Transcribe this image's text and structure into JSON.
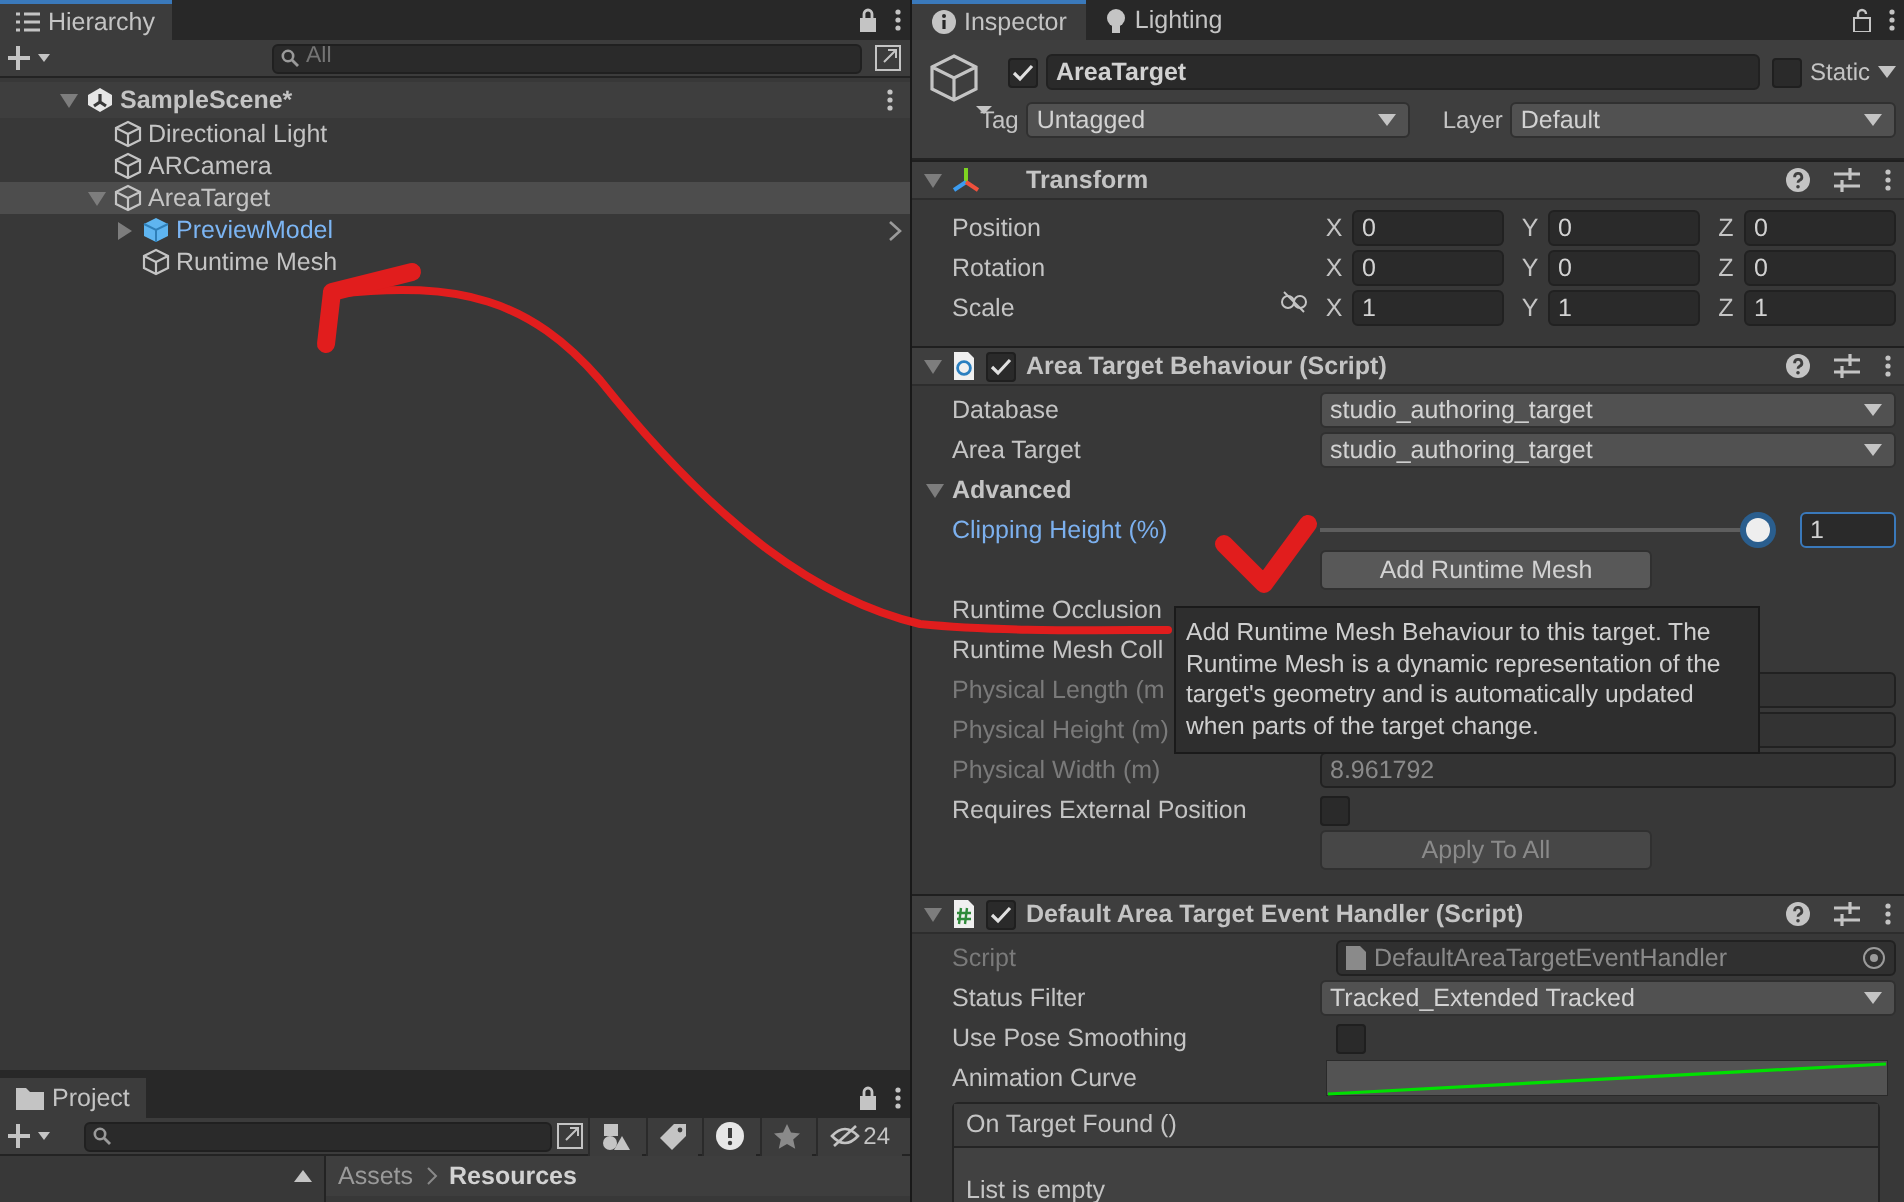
{
  "hierarchy": {
    "tab": "Hierarchy",
    "search": {
      "placeholder": "All"
    },
    "tree": [
      {
        "label": "SampleScene*",
        "kind": "scene",
        "expanded": true,
        "selected": false,
        "children": [
          {
            "label": "Directional Light",
            "kind": "object",
            "selected": false
          },
          {
            "label": "ARCamera",
            "kind": "object",
            "selected": false
          },
          {
            "label": "AreaTarget",
            "kind": "object",
            "expanded": true,
            "selected": true,
            "children": [
              {
                "label": "PreviewModel",
                "kind": "prefab",
                "expanded": false,
                "selected": false
              },
              {
                "label": "Runtime Mesh",
                "kind": "object",
                "selected": false
              }
            ]
          }
        ]
      }
    ]
  },
  "project": {
    "tab": "Project",
    "hidden_count": "24",
    "breadcrumb": [
      "Assets",
      "Resources"
    ]
  },
  "inspector": {
    "tabs": [
      {
        "label": "Inspector",
        "kind": "info",
        "selected": true
      },
      {
        "label": "Lighting",
        "kind": "bulb",
        "selected": false
      }
    ],
    "object": {
      "active": true,
      "name": "AreaTarget",
      "static": false,
      "static_label": "Static",
      "tag_label": "Tag",
      "tag": "Untagged",
      "layer_label": "Layer",
      "layer": "Default"
    },
    "components": [
      {
        "kind": "transform",
        "title": "Transform",
        "expanded": true,
        "rows": [
          {
            "label": "Position",
            "values": [
              {
                "axis": "X",
                "value": "0"
              },
              {
                "axis": "Y",
                "value": "0"
              },
              {
                "axis": "Z",
                "value": "0"
              }
            ]
          },
          {
            "label": "Rotation",
            "values": [
              {
                "axis": "X",
                "value": "0"
              },
              {
                "axis": "Y",
                "value": "0"
              },
              {
                "axis": "Z",
                "value": "0"
              }
            ]
          },
          {
            "label": "Scale",
            "linked": false,
            "values": [
              {
                "axis": "X",
                "value": "1"
              },
              {
                "axis": "Y",
                "value": "1"
              },
              {
                "axis": "Z",
                "value": "1"
              }
            ]
          }
        ]
      },
      {
        "kind": "script",
        "title": "Area Target Behaviour (Script)",
        "expanded": true,
        "enabled": true,
        "fields": [
          {
            "kind": "dropdown",
            "label": "Database",
            "value": "studio_authoring_target"
          },
          {
            "kind": "dropdown",
            "label": "Area Target",
            "value": "studio_authoring_target"
          },
          {
            "kind": "foldout",
            "label": "Advanced",
            "expanded": true
          },
          {
            "kind": "slider",
            "label": "Clipping Height (%)",
            "modified": true,
            "level": 1,
            "value": "1"
          },
          {
            "kind": "button",
            "label": "Add Runtime Mesh",
            "disabled": false
          },
          {
            "kind": "label",
            "label": "Runtime Occlusion"
          },
          {
            "kind": "label",
            "label": "Runtime Mesh Coll"
          },
          {
            "kind": "field",
            "label": "Physical Length (m",
            "disabled": true
          },
          {
            "kind": "field",
            "label": "Physical Height (m)",
            "disabled": true
          },
          {
            "kind": "field",
            "label": "Physical Width (m)",
            "value": "8.961792",
            "disabled": true
          },
          {
            "kind": "checkbox",
            "label": "Requires External Position",
            "checked": false
          },
          {
            "kind": "button",
            "label": "Apply To All",
            "disabled": true
          }
        ]
      },
      {
        "kind": "handler",
        "title": "Default Area Target Event Handler (Script)",
        "expanded": true,
        "enabled": true,
        "fields": [
          {
            "kind": "object",
            "label": "Script",
            "value": "DefaultAreaTargetEventHandler",
            "disabled": true
          },
          {
            "kind": "dropdown",
            "label": "Status Filter",
            "value": "Tracked_Extended Tracked"
          },
          {
            "kind": "checkbox",
            "label": "Use Pose Smoothing",
            "checked": false
          },
          {
            "kind": "curve",
            "label": "Animation Curve"
          },
          {
            "kind": "event",
            "label": "On Target Found ()",
            "empty_text": "List is empty"
          }
        ]
      }
    ],
    "tooltip": "Add Runtime Mesh Behaviour to this target. The Runtime Mesh is a dynamic representation of the target's geometry and is automatically updated when parts of the target change."
  }
}
